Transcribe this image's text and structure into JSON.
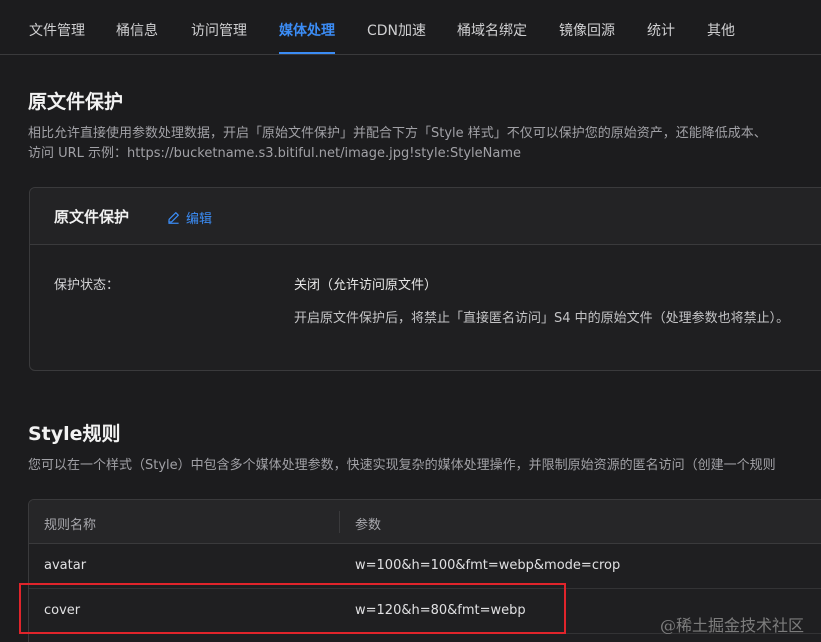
{
  "tabs": [
    {
      "label": "文件管理"
    },
    {
      "label": "桶信息"
    },
    {
      "label": "访问管理"
    },
    {
      "label": "媒体处理"
    },
    {
      "label": "CDN加速"
    },
    {
      "label": "桶域名绑定"
    },
    {
      "label": "镜像回源"
    },
    {
      "label": "统计"
    },
    {
      "label": "其他"
    }
  ],
  "active_tab": "媒体处理",
  "protect": {
    "title": "原文件保护",
    "desc_line1": "相比允许直接使用参数处理数据，开启「原始文件保护」并配合下方「Style 样式」不仅可以保护您的原始资产，还能降低成本、",
    "desc_line2": "访问 URL 示例：https://bucketname.s3.bitiful.net/image.jpg!style:StyleName",
    "card_title": "原文件保护",
    "edit_label": "编辑",
    "status_label": "保护状态：",
    "status_value": "关闭（允许访问原文件）",
    "status_note": "开启原文件保护后，将禁止「直接匿名访问」S4 中的原始文件（处理参数也将禁止）。"
  },
  "style": {
    "title": "Style规则",
    "desc": "您可以在一个样式（Style）中包含多个媒体处理参数，快速实现复杂的媒体处理操作，并限制原始资源的匿名访问（创建一个规则",
    "columns": [
      "规则名称",
      "参数"
    ],
    "rows": [
      {
        "name": "avatar",
        "params": "w=100&h=100&fmt=webp&mode=crop"
      },
      {
        "name": "cover",
        "params": "w=120&h=80&fmt=webp"
      }
    ]
  },
  "watermark": "@稀土掘金技术社区",
  "colors": {
    "accent": "#3b8cf5",
    "highlight": "#e0242b",
    "background": "#1c1c1e"
  }
}
